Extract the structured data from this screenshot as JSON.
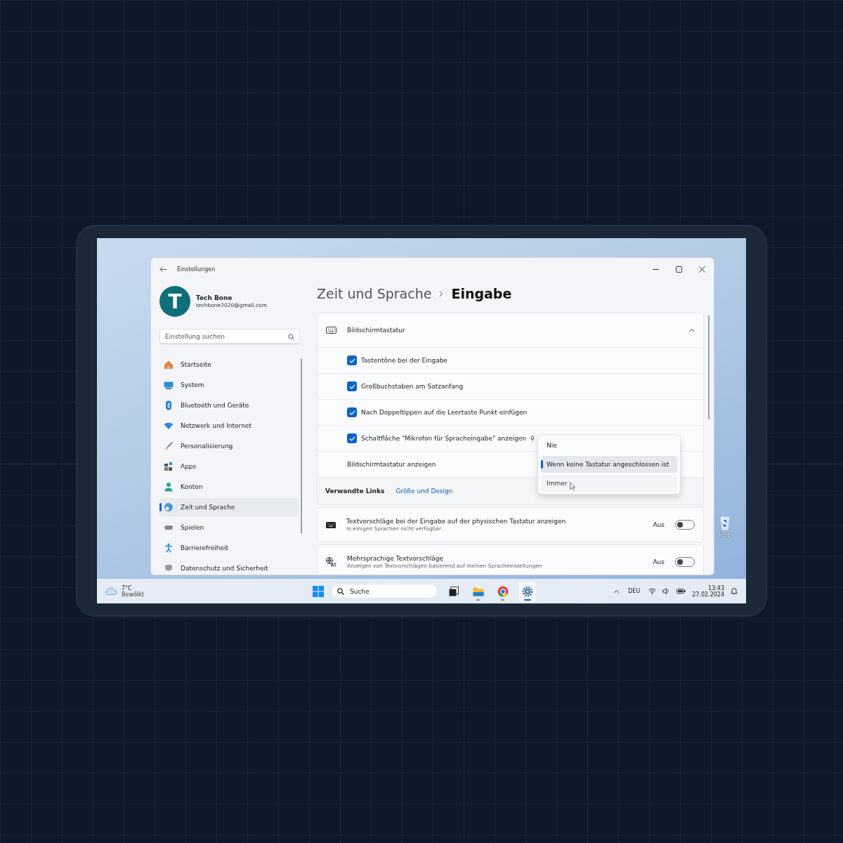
{
  "window": {
    "title": "Einstellungen"
  },
  "user": {
    "initial": "T",
    "name": "Tech Bone",
    "email": "techbone2020@gmail.com"
  },
  "search": {
    "placeholder": "Einstellung suchen"
  },
  "nav": [
    {
      "label": "Startseite",
      "selected": false
    },
    {
      "label": "System",
      "selected": false
    },
    {
      "label": "Bluetooth und Geräte",
      "selected": false
    },
    {
      "label": "Netzwerk und Internet",
      "selected": false
    },
    {
      "label": "Personalisierung",
      "selected": false
    },
    {
      "label": "Apps",
      "selected": false
    },
    {
      "label": "Konten",
      "selected": false
    },
    {
      "label": "Zeit und Sprache",
      "selected": true
    },
    {
      "label": "Spielen",
      "selected": false
    },
    {
      "label": "Barrierefreiheit",
      "selected": false
    },
    {
      "label": "Datenschutz und Sicherheit",
      "selected": false
    }
  ],
  "breadcrumb": {
    "parent": "Zeit und Sprache",
    "current": "Eingabe"
  },
  "section": {
    "title": "Bildschirmtastatur",
    "expanded": true,
    "options": [
      {
        "label": "Tastentöne bei der Eingabe",
        "checked": true,
        "mic": false
      },
      {
        "label": "Großbuchstaben am Satzanfang",
        "checked": true,
        "mic": false
      },
      {
        "label": "Nach Doppeltippen auf die Leertaste Punkt einfügen",
        "checked": true,
        "mic": false
      },
      {
        "label": "Schaltfläche \"Mikrofon für Spracheingabe\" anzeigen",
        "checked": true,
        "mic": true
      }
    ],
    "show_row": {
      "label": "Bildschirmtastatur anzeigen",
      "dropdown": [
        {
          "label": "Nie",
          "selected": false,
          "hovered": false
        },
        {
          "label": "Wenn keine Tastatur angeschlossen ist",
          "selected": true,
          "hovered": false
        },
        {
          "label": "Immer",
          "selected": false,
          "hovered": true
        }
      ]
    },
    "related": {
      "label": "Verwandte Links",
      "link": "Größe und Design"
    }
  },
  "toggles": [
    {
      "title": "Textvorschläge bei der Eingabe auf der physischen Tastatur anzeigen",
      "subtitle": "In einigen Sprachen nicht verfügbar",
      "state": "Aus",
      "on": false
    },
    {
      "title": "Mehrsprachige Textvorschläge",
      "subtitle": "Anzeigen von Textvorschlägen basierend auf meinen Spracheinstellungen",
      "state": "Aus",
      "on": false
    }
  ],
  "desktop_icon": {
    "label": "korb"
  },
  "taskbar": {
    "weather": {
      "temp": "7°C",
      "condition": "Bewölkt"
    },
    "search": "Suche",
    "apps": [
      {
        "running": false,
        "active": false
      },
      {
        "running": true,
        "active": false
      },
      {
        "running": true,
        "active": false
      },
      {
        "running": true,
        "active": true
      }
    ],
    "language": "DEU",
    "time": "13:43",
    "date": "27.02.2024"
  }
}
